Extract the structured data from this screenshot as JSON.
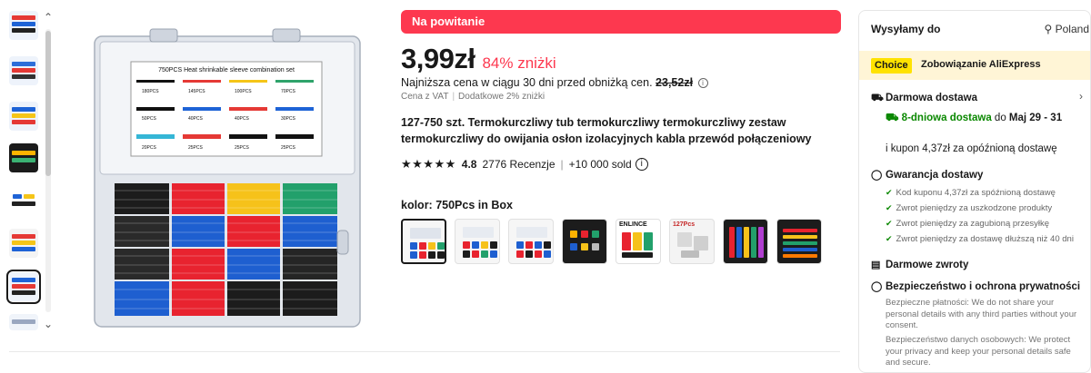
{
  "promo_banner": "Na powitanie",
  "price": "3,99zł",
  "discount": "84% zniżki",
  "lowest_price": {
    "text": "Najniższa cena w ciągu 30 dni przed obniżką cen.",
    "old_price": "23,52zł"
  },
  "vat": {
    "left": "Cena z VAT",
    "right": "Dodatkowe 2% zniżki"
  },
  "title": "127-750 szt. Termokurczliwy tub termokurczliwy termokurczliwy zestaw termokurczliwy do owijania osłon izolacyjnych kabla przewód połączeniowy",
  "rating": {
    "score": "4.8",
    "reviews": "2776 Recenzje",
    "sold": "+10 000 sold",
    "stars_value": 5
  },
  "color_label": "kolor: 750Pcs in Box",
  "variants": [
    {
      "name": "750Pcs in Box",
      "dark": false
    },
    {
      "name": "variant-2",
      "dark": false
    },
    {
      "name": "variant-3",
      "dark": false
    },
    {
      "name": "variant-4",
      "dark": true
    },
    {
      "name": "variant-5",
      "dark": false,
      "text": "ENLINCE"
    },
    {
      "name": "variant-6",
      "dark": false,
      "text": "127Pcs"
    },
    {
      "name": "variant-7",
      "dark": true
    },
    {
      "name": "variant-8",
      "dark": true
    }
  ],
  "main_image": {
    "title": "750PCS  Heat shrinkable sleeve combination set",
    "counts": [
      "180PCS",
      "145PCS",
      "100PCS",
      "70PCS",
      "50PCS",
      "40PCS",
      "40PCS",
      "30PCS",
      "20PCS",
      "25PCS",
      "25PCS",
      "25PCS"
    ]
  },
  "side": {
    "ship_to_label": "Wysyłamy do",
    "ship_to_country": "Poland",
    "choice_tag": "Choice",
    "choice_text": "Zobowiązanie AliExpress",
    "free_shipping": "Darmowa dostawa",
    "delivery_days": "8-dniowa dostawa",
    "delivery_by": "do",
    "delivery_date": "Maj 29 - 31",
    "coupon": "i kupon 4,37zł za opóźnioną dostawę",
    "guarantee_title": "Gwarancja dostawy",
    "guarantee_items": [
      "Kod kuponu 4,37zł za spóźnioną dostawę",
      "Zwrot pieniędzy za uszkodzone produkty",
      "Zwrot pieniędzy za zagubioną przesyłkę",
      "Zwrot pieniędzy za dostawę dłuższą niż 40 dni"
    ],
    "returns_title": "Darmowe zwroty",
    "privacy_title": "Bezpieczeństwo i ochrona prywatności",
    "privacy_payments": "Bezpieczne płatności: We do not share your personal details with any third parties without your consent.",
    "privacy_data": "Bezpieczeństwo danych osobowych: We protect your privacy and keep your personal details safe and secure."
  },
  "colors": {
    "promo": "#fd384f",
    "discount": "#fd384f",
    "choice_bg": "#fff5d6",
    "choice_tag": "#ffe200",
    "green": "#0a8800"
  },
  "icons": {
    "location": "location-pin-icon",
    "truck": "truck-icon",
    "shield": "shield-icon",
    "return": "return-box-icon",
    "lock": "lock-shield-icon"
  }
}
